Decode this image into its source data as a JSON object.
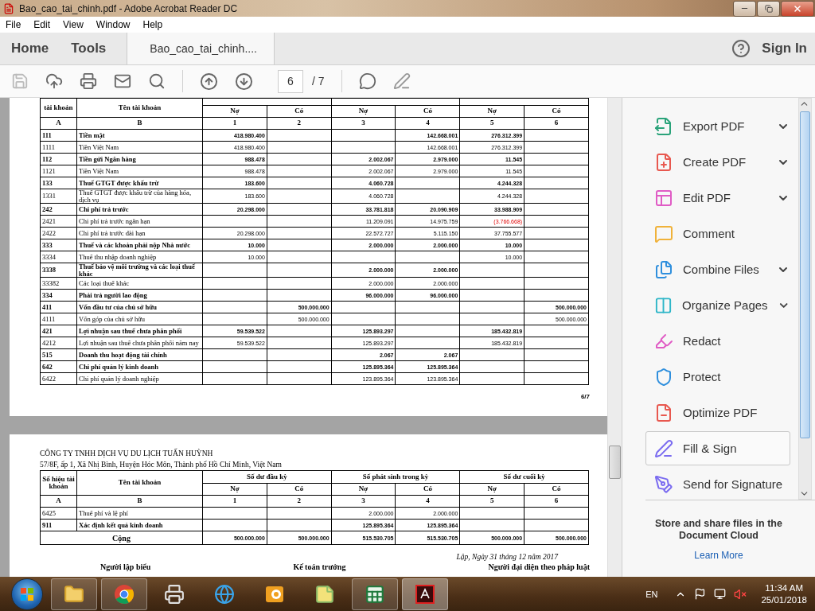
{
  "window": {
    "title": "Bao_cao_tai_chinh.pdf - Adobe Acrobat Reader DC"
  },
  "menu": [
    "File",
    "Edit",
    "View",
    "Window",
    "Help"
  ],
  "tabs": [
    {
      "label": "Home",
      "selected": false
    },
    {
      "label": "Tools",
      "selected": false
    },
    {
      "label": "Bao_cao_tai_chinh....",
      "selected": true
    }
  ],
  "sign_in": "Sign In",
  "toolbar": {
    "page": "6",
    "page_count": "/ 7"
  },
  "pages": [
    {
      "table": {
        "account_header": "tài khoản",
        "name_header": "Tên tài khoản",
        "subheaders": [
          "Nợ",
          "Có",
          "Nợ",
          "Có",
          "Nợ",
          "Có"
        ],
        "index_row": [
          "A",
          "B",
          "1",
          "2",
          "3",
          "4",
          "5",
          "6"
        ],
        "rows": [
          {
            "account": "111",
            "name": "Tiền mặt",
            "bold": true,
            "cells": [
              {
                "text": "418.980.400",
                "red": false
              },
              null,
              null,
              {
                "text": "142.668.001",
                "red": false
              },
              {
                "text": "276.312.399",
                "red": false
              },
              null
            ]
          },
          {
            "account": "1111",
            "name": "Tiền Việt Nam",
            "bold": false,
            "cells": [
              {
                "text": "418.980.400",
                "red": false
              },
              null,
              null,
              {
                "text": "142.668.001",
                "red": false
              },
              {
                "text": "276.312.399",
                "red": false
              },
              null
            ]
          },
          {
            "account": "112",
            "name": "Tiền gửi Ngân hàng",
            "bold": true,
            "cells": [
              {
                "text": "988.478",
                "red": false
              },
              null,
              {
                "text": "2.002.067",
                "red": false
              },
              {
                "text": "2.979.000",
                "red": false
              },
              {
                "text": "11.545",
                "red": false
              },
              null
            ]
          },
          {
            "account": "1121",
            "name": "Tiền Việt Nam",
            "bold": false,
            "cells": [
              {
                "text": "988.478",
                "red": false
              },
              null,
              {
                "text": "2.002.067",
                "red": false
              },
              {
                "text": "2.979.000",
                "red": false
              },
              {
                "text": "11.545",
                "red": false
              },
              null
            ]
          },
          {
            "account": "133",
            "name": "Thuế GTGT được khấu trừ",
            "bold": true,
            "cells": [
              {
                "text": "183.600",
                "red": false
              },
              null,
              {
                "text": "4.060.728",
                "red": false
              },
              null,
              {
                "text": "4.244.328",
                "red": false
              },
              null
            ]
          },
          {
            "account": "1331",
            "name": "Thuế GTGT được khấu trừ của hàng hóa, dịch vụ",
            "bold": false,
            "cells": [
              {
                "text": "183.600",
                "red": false
              },
              null,
              {
                "text": "4.060.728",
                "red": false
              },
              null,
              {
                "text": "4.244.328",
                "red": false
              },
              null
            ]
          },
          {
            "account": "242",
            "name": "Chi phí trả trước",
            "bold": true,
            "cells": [
              {
                "text": "20.298.000",
                "red": false
              },
              null,
              {
                "text": "33.781.818",
                "red": false
              },
              {
                "text": "20.090.909",
                "red": false
              },
              {
                "text": "33.988.909",
                "red": false
              },
              null
            ]
          },
          {
            "account": "2421",
            "name": "Chi phí trả trước ngắn hạn",
            "bold": false,
            "cells": [
              null,
              null,
              {
                "text": "11.209.091",
                "red": false
              },
              {
                "text": "14.975.759",
                "red": false
              },
              {
                "text": "(3.766.668)",
                "red": true
              },
              null
            ]
          },
          {
            "account": "2422",
            "name": "Chi phí trả trước dài hạn",
            "bold": false,
            "cells": [
              {
                "text": "20.298.000",
                "red": false
              },
              null,
              {
                "text": "22.572.727",
                "red": false
              },
              {
                "text": "5.115.150",
                "red": false
              },
              {
                "text": "37.755.577",
                "red": false
              },
              null
            ]
          },
          {
            "account": "333",
            "name": "Thuế và các khoản phải nộp Nhà nước",
            "bold": true,
            "cells": [
              {
                "text": "10.000",
                "red": false
              },
              null,
              {
                "text": "2.000.000",
                "red": false
              },
              {
                "text": "2.000.000",
                "red": false
              },
              {
                "text": "10.000",
                "red": false
              },
              null
            ]
          },
          {
            "account": "3334",
            "name": "Thuế thu nhập doanh nghiệp",
            "bold": false,
            "cells": [
              {
                "text": "10.000",
                "red": false
              },
              null,
              null,
              null,
              {
                "text": "10.000",
                "red": false
              },
              null
            ]
          },
          {
            "account": "3338",
            "name": "Thuế bảo vệ môi trường và các loại thuế khác",
            "bold": true,
            "cells": [
              null,
              null,
              {
                "text": "2.000.000",
                "red": false
              },
              {
                "text": "2.000.000",
                "red": false
              },
              null,
              null
            ]
          },
          {
            "account": "33382",
            "name": "Các loại thuế khác",
            "bold": false,
            "cells": [
              null,
              null,
              {
                "text": "2.000.000",
                "red": false
              },
              {
                "text": "2.000.000",
                "red": false
              },
              null,
              null
            ]
          },
          {
            "account": "334",
            "name": "Phải trả người lao động",
            "bold": true,
            "cells": [
              null,
              null,
              {
                "text": "96.000.000",
                "red": false
              },
              {
                "text": "96.000.000",
                "red": false
              },
              null,
              null
            ]
          },
          {
            "account": "411",
            "name": "Vốn đầu tư của chủ sở hữu",
            "bold": true,
            "cells": [
              null,
              {
                "text": "500.000.000",
                "red": false
              },
              null,
              null,
              null,
              {
                "text": "500.000.000",
                "red": false
              }
            ]
          },
          {
            "account": "4111",
            "name": "Vốn góp của chủ sở hữu",
            "bold": false,
            "cells": [
              null,
              {
                "text": "500.000.000",
                "red": false
              },
              null,
              null,
              null,
              {
                "text": "500.000.000",
                "red": false
              }
            ]
          },
          {
            "account": "421",
            "name": "Lợi nhuận sau thuế chưa phân phối",
            "bold": true,
            "cells": [
              {
                "text": "59.539.522",
                "red": false
              },
              null,
              {
                "text": "125.893.297",
                "red": false
              },
              null,
              {
                "text": "185.432.819",
                "red": false
              },
              null
            ]
          },
          {
            "account": "4212",
            "name": "Lợi nhuận sau thuế chưa phân phối năm nay",
            "bold": false,
            "cells": [
              {
                "text": "59.539.522",
                "red": false
              },
              null,
              {
                "text": "125.893.297",
                "red": false
              },
              null,
              {
                "text": "185.432.819",
                "red": false
              },
              null
            ]
          },
          {
            "account": "515",
            "name": "Doanh thu hoạt động tài chính",
            "bold": true,
            "cells": [
              null,
              null,
              {
                "text": "2.067",
                "red": false
              },
              {
                "text": "2.067",
                "red": false
              },
              null,
              null
            ]
          },
          {
            "account": "642",
            "name": "Chi phí quản lý kinh doanh",
            "bold": true,
            "cells": [
              null,
              null,
              {
                "text": "125.895.364",
                "red": false
              },
              {
                "text": "125.895.364",
                "red": false
              },
              null,
              null
            ]
          },
          {
            "account": "6422",
            "name": "Chi phí quản lý doanh nghiệp",
            "bold": false,
            "cells": [
              null,
              null,
              {
                "text": "123.895.364",
                "red": false
              },
              {
                "text": "123.895.364",
                "red": false
              },
              null,
              null
            ]
          }
        ]
      },
      "page_number": "6/7"
    },
    {
      "company": "CÔNG TY TNHH DỊCH VỤ DU LỊCH TUẤN HUỲNH",
      "address": "57/8F, ấp 1, Xã Nhị Bình, Huyện Hóc Môn, Thành phố Hồ Chí Minh, Việt Nam",
      "table": {
        "account_header": "Số hiệu tài khoản",
        "name_header": "Tên tài khoản",
        "groups": [
          "Số dư đầu kỳ",
          "Số phát sinh trong kỳ",
          "Số dư cuối kỳ"
        ],
        "subheaders": [
          "Nợ",
          "Có",
          "Nợ",
          "Có",
          "Nợ",
          "Có"
        ],
        "index_row": [
          "A",
          "B",
          "1",
          "2",
          "3",
          "4",
          "5",
          "6"
        ],
        "rows": [
          {
            "account": "6425",
            "name": "Thuế phí và lệ phí",
            "bold": false,
            "cells": [
              null,
              null,
              {
                "text": "2.000.000",
                "red": false
              },
              {
                "text": "2.000.000",
                "red": false
              },
              null,
              null
            ]
          },
          {
            "account": "911",
            "name": "Xác định kết quả kinh doanh",
            "bold": true,
            "cells": [
              null,
              null,
              {
                "text": "125.895.364",
                "red": false
              },
              {
                "text": "125.895.364",
                "red": false
              },
              null,
              null
            ]
          }
        ],
        "total": {
          "label": "Cộng",
          "cells": [
            "500.000.000",
            "500.000.000",
            "515.530.705",
            "515.530.705",
            "500.000.000",
            "500.000.000"
          ]
        }
      },
      "date_line": "Lập, Ngày 31 tháng 12 năm 2017",
      "signatures": [
        "Người lập biểu",
        "Kế toán trưởng",
        "Người đại diện theo pháp luật"
      ]
    }
  ],
  "tools": [
    {
      "kind": "export",
      "label": "Export PDF",
      "expandable": true,
      "selected": false
    },
    {
      "kind": "create",
      "label": "Create PDF",
      "expandable": true,
      "selected": false
    },
    {
      "kind": "edit",
      "label": "Edit PDF",
      "expandable": true,
      "selected": false
    },
    {
      "kind": "comment",
      "label": "Comment",
      "expandable": false,
      "selected": false
    },
    {
      "kind": "combine",
      "label": "Combine Files",
      "expandable": true,
      "selected": false
    },
    {
      "kind": "organize",
      "label": "Organize Pages",
      "expandable": true,
      "selected": false
    },
    {
      "kind": "redact",
      "label": "Redact",
      "expandable": false,
      "selected": false
    },
    {
      "kind": "protect",
      "label": "Protect",
      "expandable": false,
      "selected": false
    },
    {
      "kind": "optimize",
      "label": "Optimize PDF",
      "expandable": false,
      "selected": false
    },
    {
      "kind": "fill",
      "label": "Fill & Sign",
      "expandable": false,
      "selected": true
    },
    {
      "kind": "send",
      "label": "Send for Signature",
      "expandable": false,
      "selected": false
    }
  ],
  "cloud": {
    "text": "Store and share files in the Document Cloud",
    "link": "Learn More"
  },
  "taskbar": {
    "apps": [
      {
        "kind": "explorer",
        "running": true,
        "active": false
      },
      {
        "kind": "chrome",
        "running": true,
        "active": false
      },
      {
        "kind": "fax",
        "running": false,
        "active": false
      },
      {
        "kind": "ie",
        "running": false,
        "active": false
      },
      {
        "kind": "outlook",
        "running": false,
        "active": false
      },
      {
        "kind": "notes",
        "running": false,
        "active": false
      },
      {
        "kind": "excel",
        "running": true,
        "active": false
      },
      {
        "kind": "acrobat",
        "running": true,
        "active": true
      }
    ],
    "language": "EN",
    "time": "11:34 AM",
    "date": "25/01/2018"
  }
}
